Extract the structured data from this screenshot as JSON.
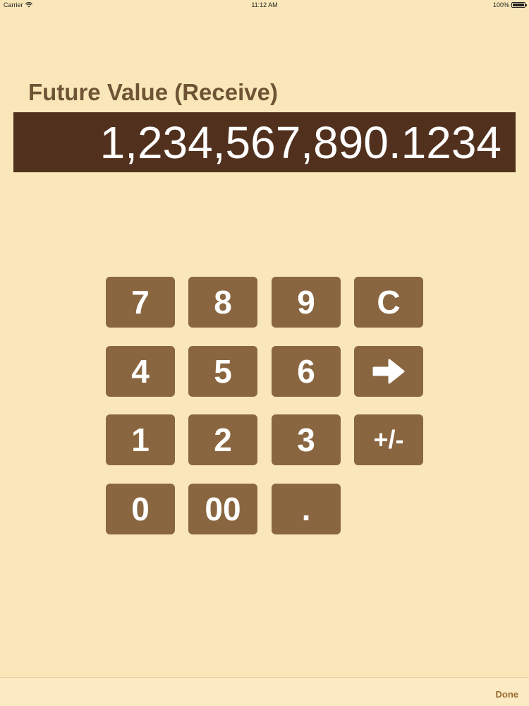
{
  "status_bar": {
    "carrier": "Carrier",
    "time": "11:12 AM",
    "battery": "100%"
  },
  "field": {
    "title": "Future Value (Receive)",
    "value": "1,234,567,890.1234"
  },
  "keypad": {
    "key_7": "7",
    "key_8": "8",
    "key_9": "9",
    "key_clear": "C",
    "key_4": "4",
    "key_5": "5",
    "key_6": "6",
    "key_next_icon": "arrow-right-icon",
    "key_1": "1",
    "key_2": "2",
    "key_3": "3",
    "key_sign": "+/-",
    "key_0": "0",
    "key_00": "00",
    "key_decimal": "."
  },
  "toolbar": {
    "done_label": "Done"
  },
  "colors": {
    "background": "#FAE7B9",
    "display_bg": "#51311D",
    "key_bg": "#8A6640",
    "title_text": "#6E5435",
    "done_text": "#9A6B33"
  }
}
